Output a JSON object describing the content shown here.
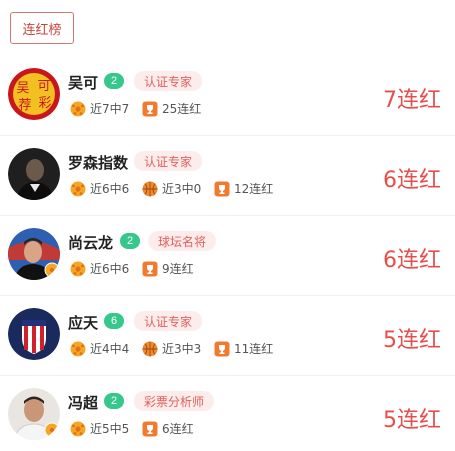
{
  "tab": {
    "label": "连红榜"
  },
  "experts": [
    {
      "name": "吴可",
      "level": "2",
      "tag": "认证专家",
      "stats": [
        "近7中7",
        "25连红"
      ],
      "streak": "7连红",
      "avatar_text": [
        "吴",
        "可",
        "荐",
        "彩"
      ]
    },
    {
      "name": "罗森指数",
      "level": "",
      "tag": "认证专家",
      "stats": [
        "近6中6",
        "近3中0",
        "12连红"
      ],
      "streak": "6连红"
    },
    {
      "name": "尚云龙",
      "level": "2",
      "tag": "球坛名将",
      "stats": [
        "近6中6",
        "9连红"
      ],
      "streak": "6连红"
    },
    {
      "name": "应天",
      "level": "6",
      "tag": "认证专家",
      "stats": [
        "近4中4",
        "近3中3",
        "11连红"
      ],
      "streak": "5连红"
    },
    {
      "name": "冯超",
      "level": "2",
      "tag": "彩票分析师",
      "stats": [
        "近5中5",
        "6连红"
      ],
      "streak": "5连红"
    }
  ],
  "colors": {
    "accent": "#e64f49",
    "level_badge": "#35c88a",
    "tag_bg": "#fdecec"
  },
  "icons": {
    "football": "football-icon",
    "basketball": "basketball-icon",
    "trophy": "trophy-icon"
  }
}
